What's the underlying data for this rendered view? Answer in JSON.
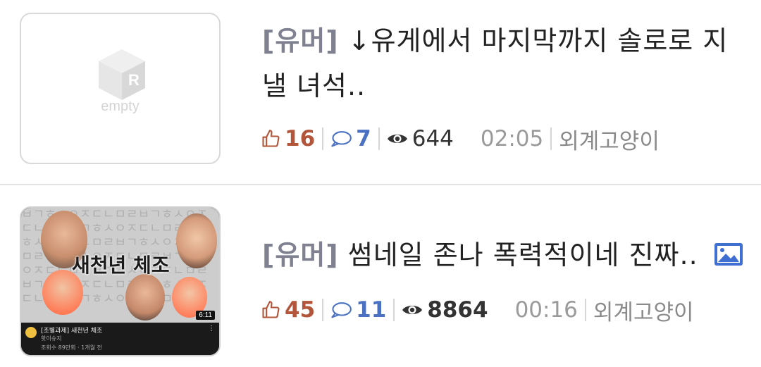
{
  "posts": [
    {
      "category": "[유머]",
      "title": "↓유게에서 마지막까지 솔로로 지낼 녀석..",
      "thumbnail_text": "empty",
      "upvotes": "16",
      "comments": "7",
      "views": "644",
      "time": "02:05",
      "author": "외계고양이",
      "has_image": false
    },
    {
      "category": "[유머]",
      "title": "썸네일 존나 폭력적이네 진짜..",
      "thumbnail_title": "새천년 체조",
      "thumbnail_duration": "6:11",
      "thumbnail_video_title": "[조별과제] 새천년 체조",
      "thumbnail_channel": "핫이슈지",
      "thumbnail_stats": "조회수 89만회 · 1개월 전",
      "upvotes": "45",
      "comments": "11",
      "views": "8864",
      "time": "00:16",
      "author": "외계고양이",
      "has_image": true
    }
  ],
  "colors": {
    "upvote": "#b2553a",
    "comment": "#4b72c2",
    "category": "#7f8190",
    "time": "#9a9a9a",
    "image_icon": "#3f6fd0"
  },
  "icons": {
    "upvote": "thumbs-up-icon",
    "comment": "speech-bubble-icon",
    "views": "eye-icon",
    "image": "image-icon"
  }
}
